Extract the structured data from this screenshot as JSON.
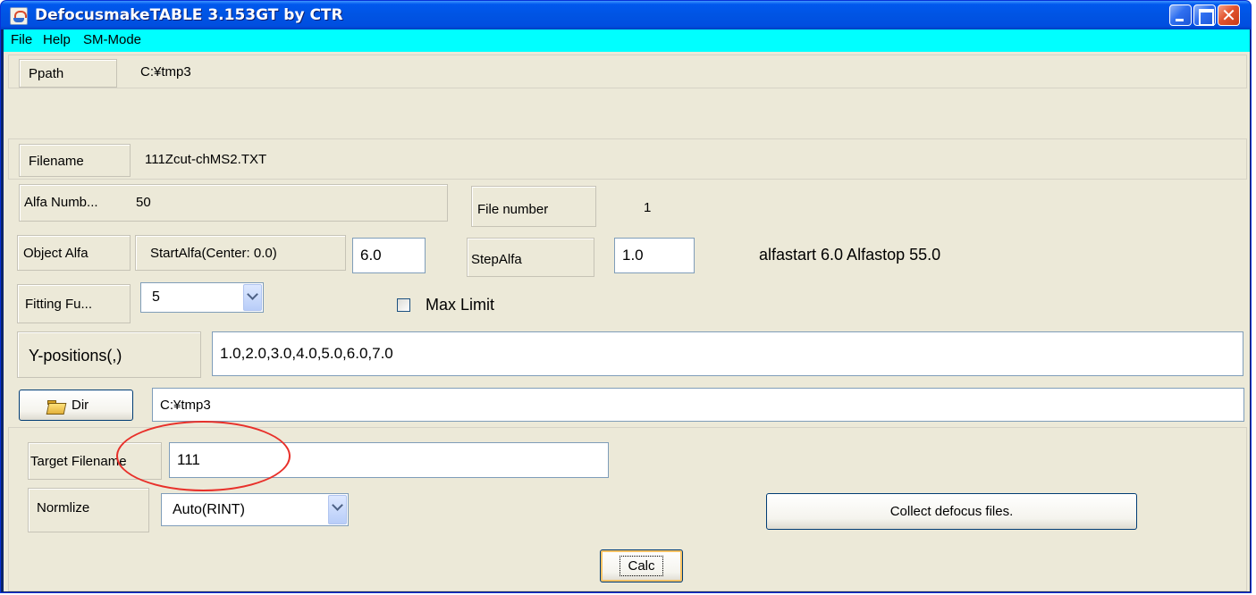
{
  "window": {
    "title": "DefocusmakeTABLE 3.153GT by CTR"
  },
  "menu": {
    "items": [
      "File",
      "Help",
      "SM-Mode"
    ]
  },
  "rows": {
    "ppath": {
      "label": "Ppath",
      "value": "C:¥tmp3"
    },
    "filename": {
      "label": "Filename",
      "value": "111Zcut-chMS2.TXT"
    },
    "alfa": {
      "label": "Alfa Numb...",
      "value": "50",
      "file_number_label": "File number",
      "file_number_value": "1"
    },
    "object_alfa": {
      "label": "Object Alfa",
      "start_label": "StartAlfa(Center: 0.0)",
      "start_value": "6.0",
      "step_label": "StepAlfa",
      "step_value": "1.0",
      "summary": "alfastart 6.0 Alfastop 55.0"
    },
    "fitting": {
      "label": "Fitting Fu...",
      "value": "5",
      "max_limit_label": "Max Limit",
      "max_limit_checked": false
    },
    "ypos": {
      "label": "Y-positions(,)",
      "value": "1.0,2.0,3.0,4.0,5.0,6.0,7.0"
    },
    "dir": {
      "button_label": "Dir",
      "value": "C:¥tmp3"
    },
    "target": {
      "label": "Target Filename",
      "value": "111"
    },
    "normalize": {
      "label": "Normlize",
      "value": "Auto(RINT)",
      "collect_label": "Collect defocus files."
    },
    "calc_label": "Calc"
  },
  "icons": {
    "app": "java-coffee-cup-icon",
    "dir": "open-folder-icon"
  },
  "colors": {
    "menubar": "#00ffff",
    "titlebar": "#0054e3",
    "panel": "#ece9d8",
    "annotation": "#e8302a"
  }
}
